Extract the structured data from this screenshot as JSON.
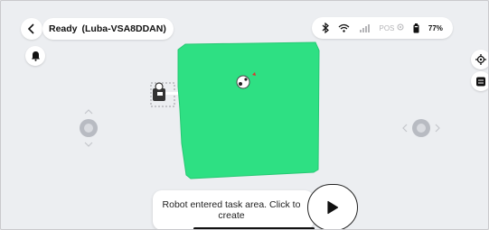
{
  "header": {
    "status": "Ready",
    "device_name": "(Luba-VSA8DDAN)"
  },
  "status_bar": {
    "bluetooth_icon": "bluetooth-icon",
    "wifi_icon": "wifi-icon",
    "cellular_icon": "cellular-icon",
    "pos_label": "POS",
    "battery_percent": "77%"
  },
  "toast": {
    "message": "Robot entered task area. Click to create"
  },
  "map": {
    "area_color": "#2ee083",
    "background_color": "#eceef1"
  },
  "colors": {
    "accent": "#2ee083",
    "text": "#111111",
    "panel": "#ffffff"
  }
}
